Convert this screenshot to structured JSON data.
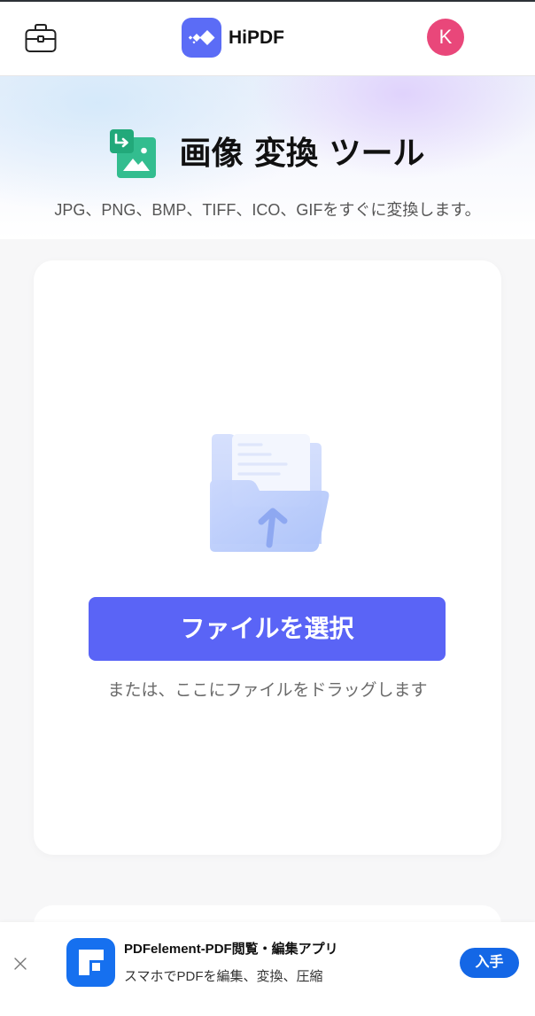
{
  "header": {
    "toolbox_icon": "briefcase-icon",
    "logo_icon": "hipdf-logo-icon",
    "brand_name": "HiPDF",
    "avatar_initial": "K"
  },
  "hero": {
    "tool_icon": "image-convert-icon",
    "title": "画像 変換 ツール",
    "subtitle": "JPG、PNG、BMP、TIFF、ICO、GIFをすぐに変換します。"
  },
  "upload": {
    "illustration_icon": "folder-upload-icon",
    "choose_file_label": "ファイルを選択",
    "drag_hint": "または、ここにファイルをドラッグします"
  },
  "app_banner": {
    "close_icon": "close-icon",
    "app_icon": "pdfelement-app-icon",
    "app_title": "PDFelement-PDF閲覧・編集アプリ",
    "app_subtitle": "スマホでPDFを編集、変換、圧縮",
    "get_label": "入手"
  },
  "colors": {
    "brand_blue": "#5b6cf6",
    "primary_button": "#5a64f6",
    "avatar": "#e9477a",
    "tool_icon_green": "#33bd8f",
    "tool_icon_green_dark": "#22a97a",
    "app_icon_blue": "#1670ef",
    "get_button": "#1467e6"
  }
}
